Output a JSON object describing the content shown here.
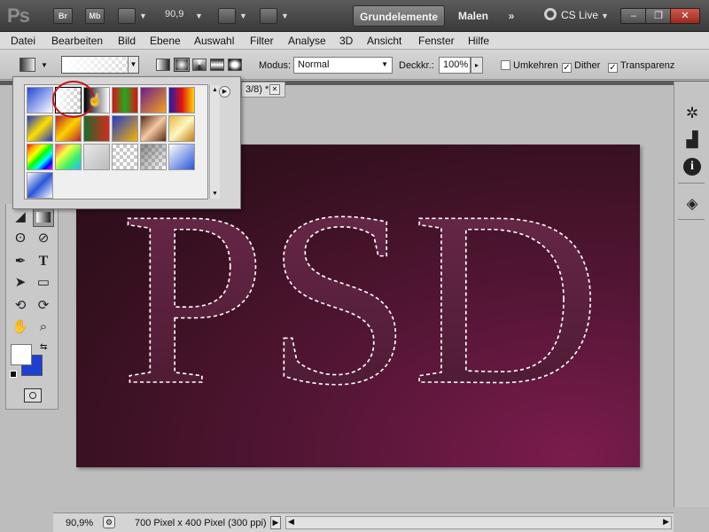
{
  "app": {
    "logo": "Ps",
    "bridge_label": "Br",
    "minibridge_label": "Mb",
    "zoom_value": "90,9",
    "workspace_active": "Grundelemente",
    "workspace_other": "Malen",
    "more_label": "»",
    "cslive_label": "CS Live",
    "window_min": "–",
    "window_restore": "❐",
    "window_close": "✕"
  },
  "menu": [
    "Datei",
    "Bearbeiten",
    "Bild",
    "Ebene",
    "Auswahl",
    "Filter",
    "Analyse",
    "3D",
    "Ansicht",
    "Fenster",
    "Hilfe"
  ],
  "options": {
    "modus_label": "Modus:",
    "modus_value": "Normal",
    "opacity_label": "Deckkr.:",
    "opacity_value": "100%",
    "reverse_label": "Umkehren",
    "reverse_checked": false,
    "dither_label": "Dither",
    "dither_checked": true,
    "transparency_label": "Transparenz",
    "transparency_checked": true
  },
  "document_tab": {
    "title_fragment": "3/8) *",
    "close": "✕"
  },
  "canvas": {
    "text": "PSD"
  },
  "gradient_picker": {
    "swatch_count": 21,
    "selected_index": 1,
    "highlight_color": "#c0151f"
  },
  "tools": {
    "type_tool": "T"
  },
  "status": {
    "zoom": "90,9%",
    "doc_info": "700 Pixel x 400 Pixel (300 ppi)"
  },
  "colors": {
    "foreground": "#ffffff",
    "background": "#1f3fd0",
    "canvas_dark": "#2a0c18",
    "canvas_highlight": "#7a1c4d"
  }
}
